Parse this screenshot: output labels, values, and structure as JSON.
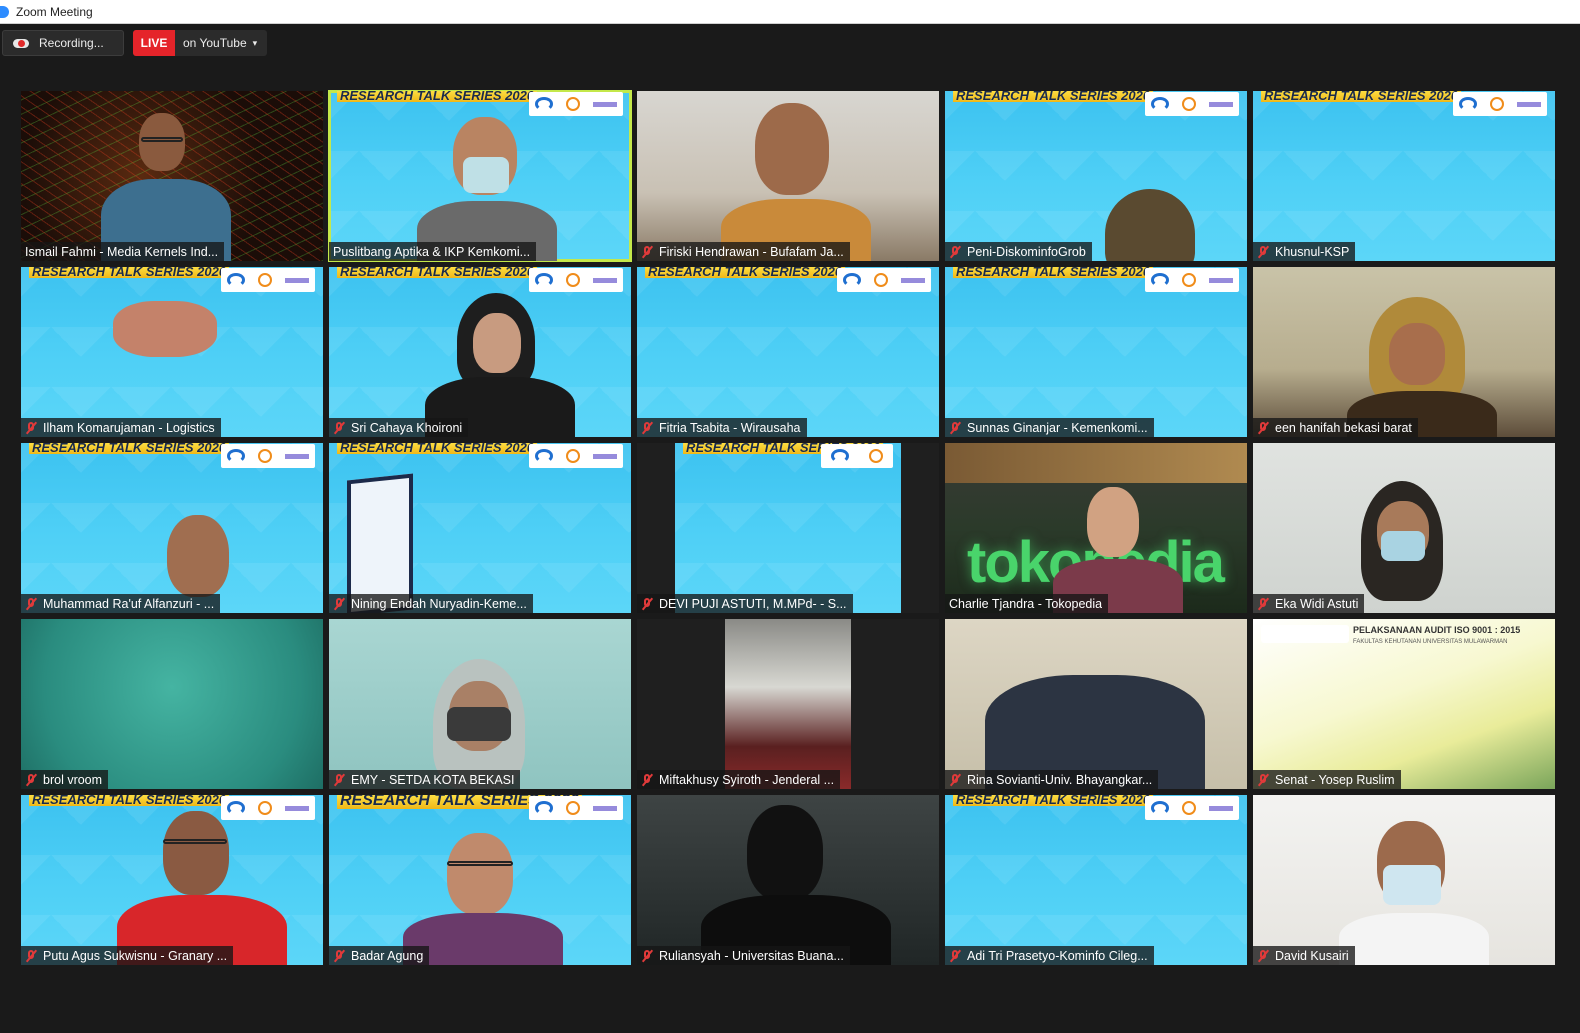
{
  "window": {
    "title": "Zoom Meeting"
  },
  "toolbar": {
    "recording_label": "Recording...",
    "live_badge": "LIVE",
    "live_target": "on YouTube",
    "live_caret": "▾"
  },
  "slide": {
    "title": "RESEARCH TALK SERIES 2020"
  },
  "tokopedia_sign": "tokopedia",
  "audit_slide": {
    "title": "PELAKSANAAN AUDIT ISO 9001 : 2015",
    "subtitle": "FAKULTAS KEHUTANAN UNIVERSITAS MULAWARMAN"
  },
  "accent_colors": {
    "active_speaker": "#c4e84a",
    "live_red": "#e5242a",
    "muted_red": "#e03a3a"
  },
  "participants": [
    {
      "name": "Ismail Fahmi - Media Kernels Ind...",
      "muted": false,
      "active": false
    },
    {
      "name": "Puslitbang Aptika & IKP Kemkomi...",
      "muted": false,
      "active": true
    },
    {
      "name": "Firiski Hendrawan - Bufafam Ja...",
      "muted": true,
      "active": false
    },
    {
      "name": "Peni-DiskominfoGrob",
      "muted": true,
      "active": false
    },
    {
      "name": "Khusnul-KSP",
      "muted": true,
      "active": false
    },
    {
      "name": "Ilham Komarujaman - Logistics",
      "muted": true,
      "active": false
    },
    {
      "name": "Sri Cahaya Khoironi",
      "muted": true,
      "active": false
    },
    {
      "name": "Fitria Tsabita - Wirausaha",
      "muted": true,
      "active": false
    },
    {
      "name": "Sunnas Ginanjar - Kemenkomi...",
      "muted": true,
      "active": false
    },
    {
      "name": "een hanifah bekasi barat",
      "muted": true,
      "active": false
    },
    {
      "name": "Muhammad Ra'uf Alfanzuri - ...",
      "muted": true,
      "active": false
    },
    {
      "name": "Nining Endah Nuryadin-Keme...",
      "muted": true,
      "active": false
    },
    {
      "name": "DEVI PUJI ASTUTI, M.MPd- - S...",
      "muted": true,
      "active": false
    },
    {
      "name": "Charlie Tjandra - Tokopedia",
      "muted": false,
      "active": false
    },
    {
      "name": "Eka Widi Astuti",
      "muted": true,
      "active": false
    },
    {
      "name": "brol vroom",
      "muted": true,
      "active": false
    },
    {
      "name": "EMY - SETDA KOTA BEKASI",
      "muted": true,
      "active": false
    },
    {
      "name": "Miftakhusy Syiroth - Jenderal ...",
      "muted": true,
      "active": false
    },
    {
      "name": "Rina Sovianti-Univ. Bhayangkar...",
      "muted": true,
      "active": false
    },
    {
      "name": "Senat - Yosep Ruslim",
      "muted": true,
      "active": false
    },
    {
      "name": "Putu Agus Sukwisnu - Granary ...",
      "muted": true,
      "active": false
    },
    {
      "name": "Badar Agung",
      "muted": true,
      "active": false
    },
    {
      "name": "Ruliansyah - Universitas Buana...",
      "muted": true,
      "active": false
    },
    {
      "name": "Adi Tri Prasetyo-Kominfo Cileg...",
      "muted": true,
      "active": false
    },
    {
      "name": "David Kusairi",
      "muted": true,
      "active": false
    }
  ]
}
